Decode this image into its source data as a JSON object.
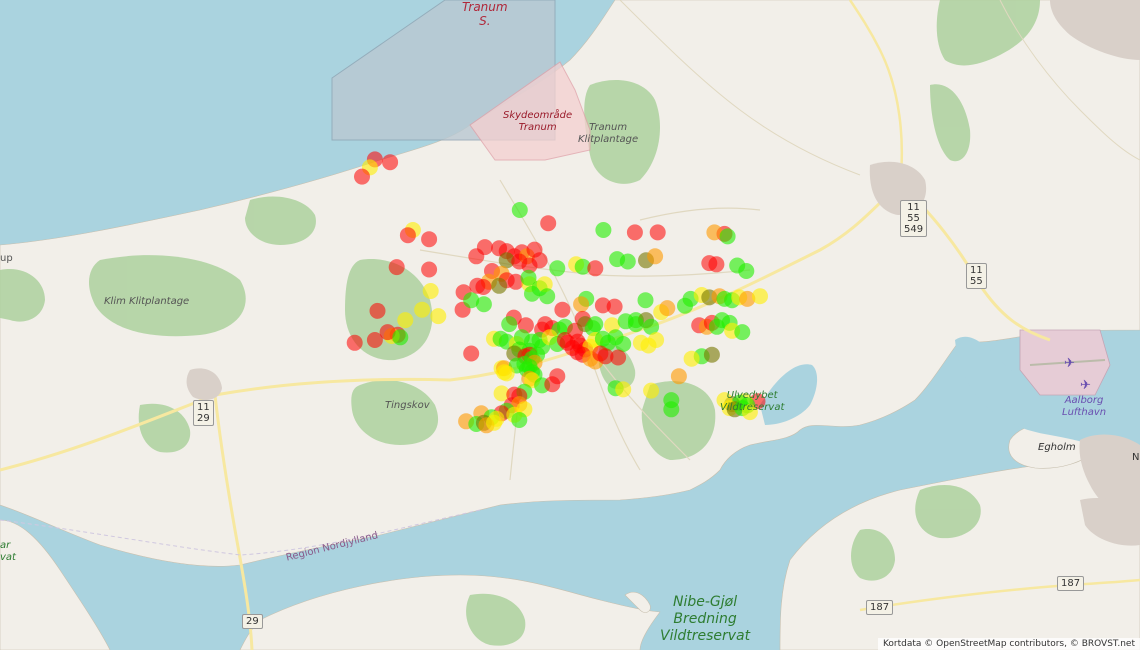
{
  "map": {
    "labels": {
      "tranum_s": "Tranum\nS.",
      "skydeomraade": "Skydeområde\nTranum",
      "tranum_klitplantage": "Tranum\nKlitplantage",
      "klim_klitplantage": "Klim Klitplantage",
      "tingskov": "Tingskov",
      "ulvedybet": "Ulvedybet\nVildtreservat",
      "aalborg_lufthavn": "Aalborg\nLufthavn",
      "egholm": "Egholm",
      "region_nordjylland": "Region Nordjylland",
      "nibe_gjol": "Nibe-Gjøl\nBredning\nVildtreservat",
      "left_edge_up": "up",
      "left_edge_ar": "ar\nvat",
      "right_edge_n": "N"
    },
    "shields": {
      "r11_29": "11\n29",
      "r11_55_549": "11\n55\n549",
      "r11_55": "11\n55",
      "r29": "29",
      "r187_a": "187",
      "r187_b": "187"
    },
    "attribution": "Kortdata © OpenStreetMap contributors, © BROVST.net"
  },
  "colors": {
    "red": "#ff0000",
    "orange": "#ff9900",
    "yellow": "#ffee00",
    "green": "#22ee00",
    "olive": "#777700",
    "water": "#aad3df",
    "land": "#f2efe9",
    "forest": "#add19e"
  },
  "observations": [
    {
      "lat": 57.16,
      "lon": 9.396,
      "status": "red"
    },
    {
      "lat": 57.1574,
      "lon": 9.392,
      "status": "yellow"
    },
    {
      "lat": 57.1544,
      "lon": 9.3858,
      "status": "red"
    },
    {
      "lat": 57.1591,
      "lon": 9.408,
      "status": "red"
    },
    {
      "lat": 57.1435,
      "lon": 9.5104,
      "status": "green"
    },
    {
      "lat": 57.1392,
      "lon": 9.5328,
      "status": "red"
    },
    {
      "lat": 57.137,
      "lon": 9.5764,
      "status": "green"
    },
    {
      "lat": 57.1362,
      "lon": 9.6012,
      "status": "red"
    },
    {
      "lat": 57.1362,
      "lon": 9.6192,
      "status": "red"
    },
    {
      "lat": 57.1357,
      "lon": 9.672,
      "status": "red"
    },
    {
      "lat": 57.1362,
      "lon": 9.664,
      "status": "orange"
    },
    {
      "lat": 57.1349,
      "lon": 9.6744,
      "status": "green"
    },
    {
      "lat": 57.137,
      "lon": 9.426,
      "status": "yellow"
    },
    {
      "lat": 57.1353,
      "lon": 9.422,
      "status": "red"
    },
    {
      "lat": 57.134,
      "lon": 9.4388,
      "status": "red"
    },
    {
      "lat": 57.1314,
      "lon": 9.4828,
      "status": "red"
    },
    {
      "lat": 57.131,
      "lon": 9.494,
      "status": "red"
    },
    {
      "lat": 57.1301,
      "lon": 9.5,
      "status": "red"
    },
    {
      "lat": 57.1284,
      "lon": 9.506,
      "status": "red"
    },
    {
      "lat": 57.1297,
      "lon": 9.512,
      "status": "red"
    },
    {
      "lat": 57.1284,
      "lon": 9.516,
      "status": "orange"
    },
    {
      "lat": 57.1306,
      "lon": 9.522,
      "status": "red"
    },
    {
      "lat": 57.1284,
      "lon": 9.476,
      "status": "red"
    },
    {
      "lat": 57.1271,
      "lon": 9.526,
      "status": "red"
    },
    {
      "lat": 57.1271,
      "lon": 9.5,
      "status": "olive"
    },
    {
      "lat": 57.1267,
      "lon": 9.51,
      "status": "red"
    },
    {
      "lat": 57.1254,
      "lon": 9.518,
      "status": "red"
    },
    {
      "lat": 57.1249,
      "lon": 9.4132,
      "status": "red"
    },
    {
      "lat": 57.1241,
      "lon": 9.4388,
      "status": "red"
    },
    {
      "lat": 57.1236,
      "lon": 9.4884,
      "status": "red"
    },
    {
      "lat": 57.1227,
      "lon": 9.496,
      "status": "orange"
    },
    {
      "lat": 57.1245,
      "lon": 9.54,
      "status": "green"
    },
    {
      "lat": 57.1258,
      "lon": 9.5548,
      "status": "yellow"
    },
    {
      "lat": 57.125,
      "lon": 9.56,
      "status": "green"
    },
    {
      "lat": 57.1245,
      "lon": 9.57,
      "status": "red"
    },
    {
      "lat": 57.1275,
      "lon": 9.5872,
      "status": "green"
    },
    {
      "lat": 57.1267,
      "lon": 9.5956,
      "status": "green"
    },
    {
      "lat": 57.1271,
      "lon": 9.61,
      "status": "olive"
    },
    {
      "lat": 57.1284,
      "lon": 9.6172,
      "status": "orange"
    },
    {
      "lat": 57.1262,
      "lon": 9.66,
      "status": "red"
    },
    {
      "lat": 57.1258,
      "lon": 9.6656,
      "status": "red"
    },
    {
      "lat": 57.1254,
      "lon": 9.682,
      "status": "green"
    },
    {
      "lat": 57.1236,
      "lon": 9.6892,
      "status": "green"
    },
    {
      "lat": 57.1206,
      "lon": 9.5,
      "status": "red"
    },
    {
      "lat": 57.1201,
      "lon": 9.5072,
      "status": "red"
    },
    {
      "lat": 57.1201,
      "lon": 9.486,
      "status": "orange"
    },
    {
      "lat": 57.1188,
      "lon": 9.494,
      "status": "olive"
    },
    {
      "lat": 57.1184,
      "lon": 9.4816,
      "status": "red"
    },
    {
      "lat": 57.1188,
      "lon": 9.4768,
      "status": "red"
    },
    {
      "lat": 57.1193,
      "lon": 9.518,
      "status": "yellow"
    },
    {
      "lat": 57.1214,
      "lon": 9.5172,
      "status": "green"
    },
    {
      "lat": 57.118,
      "lon": 9.526,
      "status": "green"
    },
    {
      "lat": 57.1193,
      "lon": 9.53,
      "status": "yellow"
    },
    {
      "lat": 57.1167,
      "lon": 9.466,
      "status": "red"
    },
    {
      "lat": 57.1171,
      "lon": 9.44,
      "status": "yellow"
    },
    {
      "lat": 57.1162,
      "lon": 9.52,
      "status": "green"
    },
    {
      "lat": 57.1154,
      "lon": 9.532,
      "status": "green"
    },
    {
      "lat": 57.1145,
      "lon": 9.5628,
      "status": "green"
    },
    {
      "lat": 57.1128,
      "lon": 9.5588,
      "status": "orange"
    },
    {
      "lat": 57.111,
      "lon": 9.544,
      "status": "red"
    },
    {
      "lat": 57.111,
      "lon": 9.4652,
      "status": "red"
    },
    {
      "lat": 57.1102,
      "lon": 9.622,
      "status": "yellow"
    },
    {
      "lat": 57.1115,
      "lon": 9.6268,
      "status": "orange"
    },
    {
      "lat": 57.1123,
      "lon": 9.6408,
      "status": "green"
    },
    {
      "lat": 57.1145,
      "lon": 9.6452,
      "status": "green"
    },
    {
      "lat": 57.1158,
      "lon": 9.654,
      "status": "yellow"
    },
    {
      "lat": 57.115,
      "lon": 9.66,
      "status": "olive"
    },
    {
      "lat": 57.1154,
      "lon": 9.668,
      "status": "orange"
    },
    {
      "lat": 57.1145,
      "lon": 9.672,
      "status": "green"
    },
    {
      "lat": 57.1141,
      "lon": 9.678,
      "status": "green"
    },
    {
      "lat": 57.115,
      "lon": 9.6836,
      "status": "yellow"
    },
    {
      "lat": 57.1145,
      "lon": 9.69,
      "status": "orange"
    },
    {
      "lat": 57.1154,
      "lon": 9.7,
      "status": "yellow"
    },
    {
      "lat": 57.1141,
      "lon": 9.6096,
      "status": "green"
    },
    {
      "lat": 57.1124,
      "lon": 9.576,
      "status": "red"
    },
    {
      "lat": 57.112,
      "lon": 9.5852,
      "status": "red"
    },
    {
      "lat": 57.1128,
      "lon": 9.482,
      "status": "green"
    },
    {
      "lat": 57.1141,
      "lon": 9.472,
      "status": "green"
    },
    {
      "lat": 57.111,
      "lon": 9.4332,
      "status": "yellow"
    },
    {
      "lat": 57.1106,
      "lon": 9.398,
      "status": "red"
    },
    {
      "lat": 57.1084,
      "lon": 9.5056,
      "status": "red"
    },
    {
      "lat": 57.108,
      "lon": 9.56,
      "status": "red"
    },
    {
      "lat": 57.1089,
      "lon": 9.446,
      "status": "yellow"
    },
    {
      "lat": 57.1076,
      "lon": 9.42,
      "status": "yellow"
    },
    {
      "lat": 57.1063,
      "lon": 9.502,
      "status": "green"
    },
    {
      "lat": 57.1059,
      "lon": 9.5152,
      "status": "red"
    },
    {
      "lat": 57.1063,
      "lon": 9.5304,
      "status": "red"
    },
    {
      "lat": 57.1045,
      "lon": 9.528,
      "status": "red"
    },
    {
      "lat": 57.105,
      "lon": 9.536,
      "status": "red"
    },
    {
      "lat": 57.1045,
      "lon": 9.5416,
      "status": "green"
    },
    {
      "lat": 57.1054,
      "lon": 9.546,
      "status": "green"
    },
    {
      "lat": 57.1041,
      "lon": 9.554,
      "status": "red"
    },
    {
      "lat": 57.1063,
      "lon": 9.562,
      "status": "olive"
    },
    {
      "lat": 57.1063,
      "lon": 9.57,
      "status": "green"
    },
    {
      "lat": 57.105,
      "lon": 9.568,
      "status": "green"
    },
    {
      "lat": 57.1059,
      "lon": 9.5832,
      "status": "yellow"
    },
    {
      "lat": 57.1072,
      "lon": 9.594,
      "status": "green"
    },
    {
      "lat": 57.1076,
      "lon": 9.602,
      "status": "green"
    },
    {
      "lat": 57.1076,
      "lon": 9.61,
      "status": "olive"
    },
    {
      "lat": 57.1063,
      "lon": 9.602,
      "status": "green"
    },
    {
      "lat": 57.1059,
      "lon": 9.652,
      "status": "red"
    },
    {
      "lat": 57.1054,
      "lon": 9.658,
      "status": "orange"
    },
    {
      "lat": 57.1067,
      "lon": 9.662,
      "status": "red"
    },
    {
      "lat": 57.1054,
      "lon": 9.666,
      "status": "green"
    },
    {
      "lat": 57.1076,
      "lon": 9.67,
      "status": "green"
    },
    {
      "lat": 57.1067,
      "lon": 9.676,
      "status": "green"
    },
    {
      "lat": 57.1041,
      "lon": 9.678,
      "status": "yellow"
    },
    {
      "lat": 57.1037,
      "lon": 9.686,
      "status": "green"
    },
    {
      "lat": 57.1054,
      "lon": 9.614,
      "status": "green"
    },
    {
      "lat": 57.1028,
      "lon": 9.414,
      "status": "red"
    },
    {
      "lat": 57.1024,
      "lon": 9.4092,
      "status": "yellow"
    },
    {
      "lat": 57.1037,
      "lon": 9.406,
      "status": "red"
    },
    {
      "lat": 57.1011,
      "lon": 9.396,
      "status": "red"
    },
    {
      "lat": 57.1002,
      "lon": 9.38,
      "status": "red"
    },
    {
      "lat": 57.102,
      "lon": 9.416,
      "status": "green"
    },
    {
      "lat": 57.1015,
      "lon": 9.49,
      "status": "yellow"
    },
    {
      "lat": 57.1015,
      "lon": 9.4952,
      "status": "green"
    },
    {
      "lat": 57.1006,
      "lon": 9.5,
      "status": "green"
    },
    {
      "lat": 57.0998,
      "lon": 9.508,
      "status": "yellow"
    },
    {
      "lat": 57.102,
      "lon": 9.512,
      "status": "green"
    },
    {
      "lat": 57.1006,
      "lon": 9.52,
      "status": "green"
    },
    {
      "lat": 57.1011,
      "lon": 9.526,
      "status": "green"
    },
    {
      "lat": 57.0989,
      "lon": 9.528,
      "status": "green"
    },
    {
      "lat": 57.102,
      "lon": 9.534,
      "status": "yellow"
    },
    {
      "lat": 57.0998,
      "lon": 9.54,
      "status": "green"
    },
    {
      "lat": 57.1011,
      "lon": 9.546,
      "status": "red"
    },
    {
      "lat": 57.1002,
      "lon": 9.548,
      "status": "red"
    },
    {
      "lat": 57.0985,
      "lon": 9.552,
      "status": "red"
    },
    {
      "lat": 57.1006,
      "lon": 9.556,
      "status": "red"
    },
    {
      "lat": 57.0993,
      "lon": 9.558,
      "status": "red"
    },
    {
      "lat": 57.098,
      "lon": 9.562,
      "status": "red"
    },
    {
      "lat": 57.0989,
      "lon": 9.566,
      "status": "yellow"
    },
    {
      "lat": 57.1011,
      "lon": 9.57,
      "status": "yellow"
    },
    {
      "lat": 57.1015,
      "lon": 9.576,
      "status": "green"
    },
    {
      "lat": 57.1002,
      "lon": 9.58,
      "status": "green"
    },
    {
      "lat": 57.102,
      "lon": 9.586,
      "status": "green"
    },
    {
      "lat": 57.0998,
      "lon": 9.592,
      "status": "green"
    },
    {
      "lat": 57.1002,
      "lon": 9.606,
      "status": "yellow"
    },
    {
      "lat": 57.0993,
      "lon": 9.612,
      "status": "yellow"
    },
    {
      "lat": 57.1011,
      "lon": 9.618,
      "status": "yellow"
    },
    {
      "lat": 57.098,
      "lon": 9.51,
      "status": "green"
    },
    {
      "lat": 57.0976,
      "lon": 9.518,
      "status": "green"
    },
    {
      "lat": 57.0963,
      "lon": 9.518,
      "status": "red"
    },
    {
      "lat": 57.0967,
      "lon": 9.506,
      "status": "olive"
    },
    {
      "lat": 57.0958,
      "lon": 9.5148,
      "status": "red"
    },
    {
      "lat": 57.095,
      "lon": 9.52,
      "status": "green"
    },
    {
      "lat": 57.0963,
      "lon": 9.524,
      "status": "green"
    },
    {
      "lat": 57.0937,
      "lon": 9.522,
      "status": "orange"
    },
    {
      "lat": 57.0967,
      "lon": 9.472,
      "status": "red"
    },
    {
      "lat": 57.0963,
      "lon": 9.56,
      "status": "red"
    },
    {
      "lat": 57.0971,
      "lon": 9.556,
      "status": "red"
    },
    {
      "lat": 57.095,
      "lon": 9.566,
      "status": "orange"
    },
    {
      "lat": 57.0941,
      "lon": 9.57,
      "status": "orange"
    },
    {
      "lat": 57.0958,
      "lon": 9.578,
      "status": "red"
    },
    {
      "lat": 57.0967,
      "lon": 9.574,
      "status": "red"
    },
    {
      "lat": 57.0954,
      "lon": 9.588,
      "status": "red"
    },
    {
      "lat": 57.0958,
      "lon": 9.654,
      "status": "green"
    },
    {
      "lat": 57.095,
      "lon": 9.646,
      "status": "yellow"
    },
    {
      "lat": 57.0963,
      "lon": 9.662,
      "status": "olive"
    },
    {
      "lat": 57.0919,
      "lon": 9.496,
      "status": "yellow"
    },
    {
      "lat": 57.0919,
      "lon": 9.498,
      "status": "orange"
    },
    {
      "lat": 57.0928,
      "lon": 9.508,
      "status": "green"
    },
    {
      "lat": 57.0933,
      "lon": 9.514,
      "status": "green"
    },
    {
      "lat": 57.0915,
      "lon": 9.516,
      "status": "green"
    },
    {
      "lat": 57.0906,
      "lon": 9.498,
      "status": "yellow"
    },
    {
      "lat": 57.0902,
      "lon": 9.5,
      "status": "yellow"
    },
    {
      "lat": 57.0893,
      "lon": 9.54,
      "status": "red"
    },
    {
      "lat": 57.0924,
      "lon": 9.518,
      "status": "green"
    },
    {
      "lat": 57.0906,
      "lon": 9.52,
      "status": "green"
    },
    {
      "lat": 57.0898,
      "lon": 9.522,
      "status": "green"
    },
    {
      "lat": 57.0885,
      "lon": 9.518,
      "status": "orange"
    },
    {
      "lat": 57.0893,
      "lon": 9.636,
      "status": "orange"
    },
    {
      "lat": 57.088,
      "lon": 9.52,
      "status": "yellow"
    },
    {
      "lat": 57.0863,
      "lon": 9.528,
      "status": "green"
    },
    {
      "lat": 57.0867,
      "lon": 9.536,
      "status": "red"
    },
    {
      "lat": 57.0854,
      "lon": 9.586,
      "status": "green"
    },
    {
      "lat": 57.085,
      "lon": 9.592,
      "status": "yellow"
    },
    {
      "lat": 57.0846,
      "lon": 9.614,
      "status": "yellow"
    },
    {
      "lat": 57.0837,
      "lon": 9.496,
      "status": "yellow"
    },
    {
      "lat": 57.0833,
      "lon": 9.506,
      "status": "red"
    },
    {
      "lat": 57.0842,
      "lon": 9.514,
      "status": "green"
    },
    {
      "lat": 57.0828,
      "lon": 9.51,
      "status": "red"
    },
    {
      "lat": 57.0815,
      "lon": 9.63,
      "status": "green"
    },
    {
      "lat": 57.0811,
      "lon": 9.698,
      "status": "red"
    },
    {
      "lat": 57.0811,
      "lon": 9.688,
      "status": "yellow"
    },
    {
      "lat": 57.0802,
      "lon": 9.678,
      "status": "olive"
    },
    {
      "lat": 57.0807,
      "lon": 9.684,
      "status": "green"
    },
    {
      "lat": 57.0798,
      "lon": 9.69,
      "status": "green"
    },
    {
      "lat": 57.0815,
      "lon": 9.672,
      "status": "yellow"
    },
    {
      "lat": 57.0789,
      "lon": 9.676,
      "status": "yellow"
    },
    {
      "lat": 57.0785,
      "lon": 9.68,
      "status": "olive"
    },
    {
      "lat": 57.0789,
      "lon": 9.686,
      "status": "green"
    },
    {
      "lat": 57.0776,
      "lon": 9.692,
      "status": "yellow"
    },
    {
      "lat": 57.0785,
      "lon": 9.63,
      "status": "green"
    },
    {
      "lat": 57.0798,
      "lon": 9.504,
      "status": "red"
    },
    {
      "lat": 57.0802,
      "lon": 9.51,
      "status": "orange"
    },
    {
      "lat": 57.0785,
      "lon": 9.514,
      "status": "yellow"
    },
    {
      "lat": 57.078,
      "lon": 9.5,
      "status": "green"
    },
    {
      "lat": 57.0772,
      "lon": 9.496,
      "status": "red"
    },
    {
      "lat": 57.0772,
      "lon": 9.48,
      "status": "orange"
    },
    {
      "lat": 57.0759,
      "lon": 9.488,
      "status": "green"
    },
    {
      "lat": 57.0754,
      "lon": 9.492,
      "status": "yellow"
    },
    {
      "lat": 57.0767,
      "lon": 9.506,
      "status": "yellow"
    },
    {
      "lat": 57.075,
      "lon": 9.51,
      "status": "green"
    },
    {
      "lat": 57.0746,
      "lon": 9.468,
      "status": "orange"
    },
    {
      "lat": 57.0737,
      "lon": 9.476,
      "status": "green"
    },
    {
      "lat": 57.0741,
      "lon": 9.482,
      "status": "olive"
    },
    {
      "lat": 57.0733,
      "lon": 9.484,
      "status": "orange"
    },
    {
      "lat": 57.0741,
      "lon": 9.49,
      "status": "yellow"
    }
  ]
}
